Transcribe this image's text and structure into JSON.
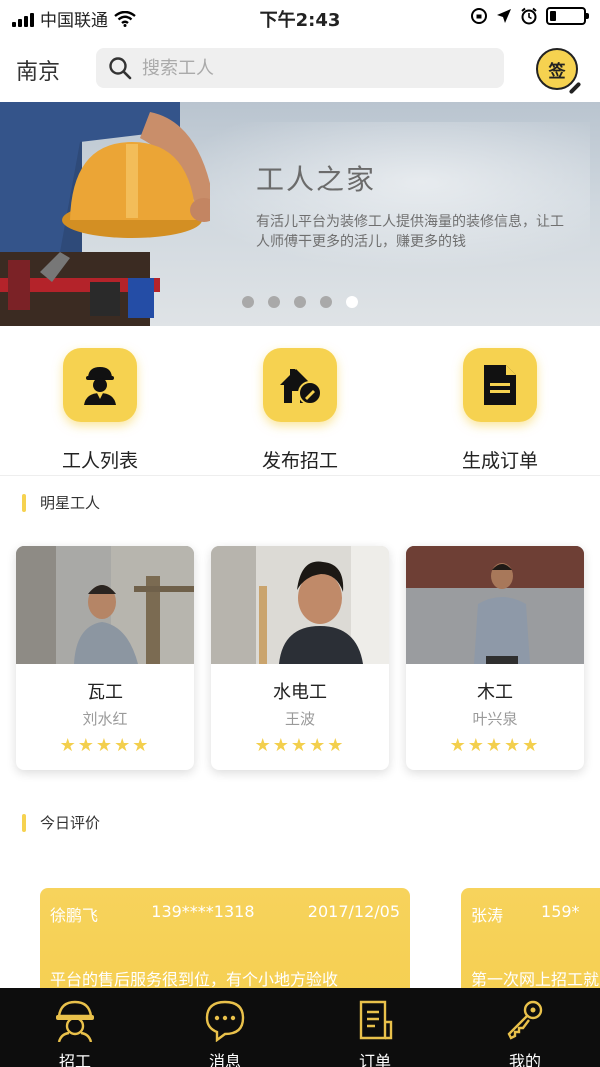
{
  "status_bar": {
    "carrier": "中国联通",
    "time": "下午2:43",
    "battery_level": 0.2
  },
  "header": {
    "city": "南京",
    "search_placeholder": "搜索工人",
    "sign_label": "签"
  },
  "banner": {
    "title": "工人之家",
    "description": "有活儿平台为装修工人提供海量的装修信息，让工人师傅干更多的活儿，赚更多的钱",
    "slide_count": 5,
    "active_slide": 5
  },
  "actions": [
    {
      "label": "工人列表",
      "icon": "worker-icon"
    },
    {
      "label": "发布招工",
      "icon": "house-pen-icon"
    },
    {
      "label": "生成订单",
      "icon": "document-icon"
    }
  ],
  "star_workers": {
    "title": "明星工人",
    "items": [
      {
        "trade": "瓦工",
        "name": "刘水红",
        "rating": 5,
        "stars": "★★★★★"
      },
      {
        "trade": "水电工",
        "name": "王波",
        "rating": 5,
        "stars": "★★★★★"
      },
      {
        "trade": "木工",
        "name": "叶兴泉",
        "rating": 5,
        "stars": "★★★★★"
      }
    ]
  },
  "reviews": {
    "title": "今日评价",
    "items": [
      {
        "user": "徐鹏飞",
        "phone": "139****1318",
        "date": "2017/12/05",
        "text": "平台的售后服务很到位，有个小地方验收"
      },
      {
        "user": "张涛",
        "phone": "159*",
        "date": "",
        "text": "第一次网上招工就"
      }
    ]
  },
  "tabbar": {
    "items": [
      {
        "label": "招工",
        "icon": "hardhat-icon",
        "active": true
      },
      {
        "label": "消息",
        "icon": "chat-icon",
        "active": false
      },
      {
        "label": "订单",
        "icon": "order-icon",
        "active": false
      },
      {
        "label": "我的",
        "icon": "key-icon",
        "active": false
      }
    ]
  },
  "colors": {
    "accent": "#f6d250",
    "tabbar_bg": "#0d0d0d",
    "star": "#f3cf4d"
  }
}
